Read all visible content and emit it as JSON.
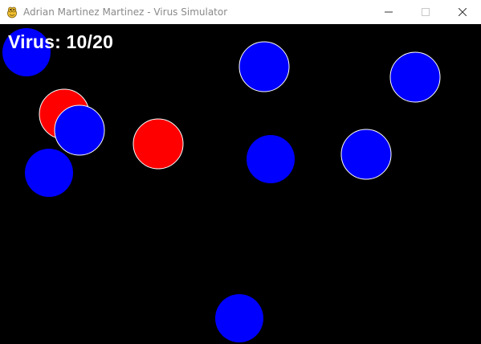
{
  "window": {
    "title": "Adrian Martinez Martinez - Virus Simulator",
    "app_icon": "pygame-snake-icon",
    "controls": [
      {
        "name": "minimize-button",
        "icon": "minimize-icon"
      },
      {
        "name": "maximize-button",
        "icon": "maximize-icon"
      },
      {
        "name": "close-button",
        "icon": "close-icon"
      }
    ]
  },
  "hud": {
    "virus_label": "Virus: 10/20"
  },
  "colors": {
    "background": "#000000",
    "healthy": "#0000ff",
    "infected": "#ff0000",
    "outline": "#ffffff",
    "text": "#ffffff"
  }
}
